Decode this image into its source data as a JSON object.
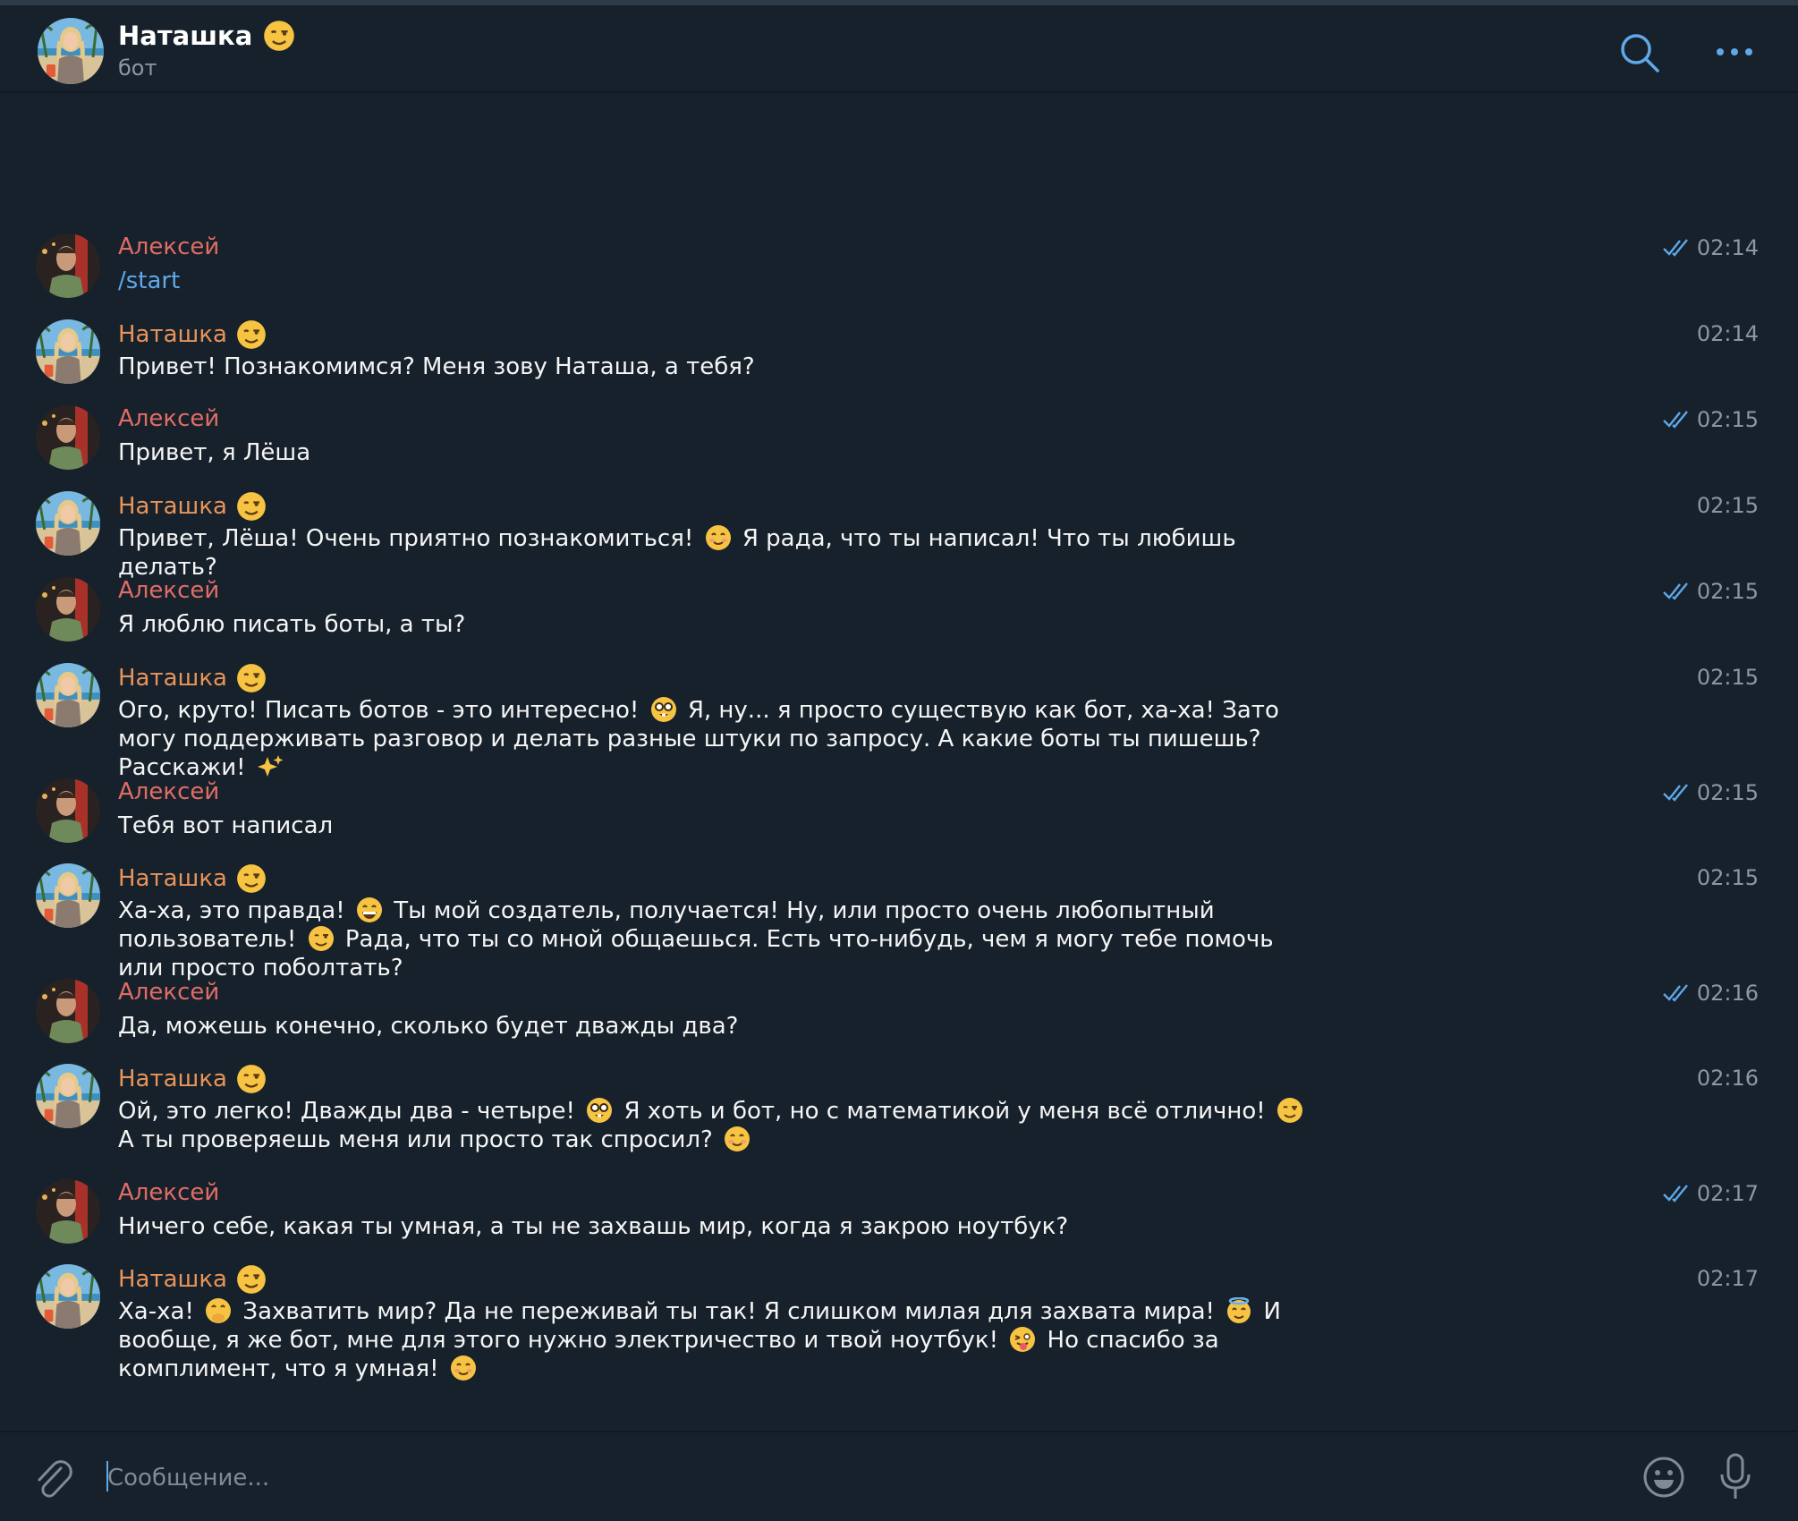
{
  "header": {
    "title": "Наташка",
    "subtitle": "бот"
  },
  "composer": {
    "placeholder": "Сообщение..."
  },
  "icons": {
    "search": "search-icon",
    "more": "more-icon",
    "attach": "paperclip-icon",
    "emoji": "smile-icon",
    "mic": "microphone-icon"
  },
  "colors": {
    "background": "#17212b",
    "user_name": "#e06c66",
    "bot_name": "#e8945a",
    "link": "#5fa8ea",
    "check": "#5fa8ea"
  },
  "messages": [
    {
      "sender": "Алексей",
      "time": "02:14",
      "text": "/start"
    },
    {
      "sender": "Наташка",
      "time": "02:14",
      "text": "Привет! Познакомимся? Меня зову Наташа, а тебя?"
    },
    {
      "sender": "Алексей",
      "time": "02:15",
      "text": "Привет, я Лёша"
    },
    {
      "sender": "Наташка",
      "time": "02:15",
      "text_a": "Привет, Лёша! Очень приятно познакомиться!",
      "text_b": "Я рада, что ты написал! Что ты любишь делать?"
    },
    {
      "sender": "Алексей",
      "time": "02:15",
      "text": "Я люблю писать боты, а ты?"
    },
    {
      "sender": "Наташка",
      "time": "02:15",
      "text_a": "Ого, круто! Писать ботов - это интересно!",
      "text_b": "Я, ну... я просто существую как бот, ха-ха! Зато могу поддерживать разговор и делать разные штуки по запросу. А какие боты ты пишешь? Расскажи!"
    },
    {
      "sender": "Алексей",
      "time": "02:15",
      "text": "Тебя вот написал"
    },
    {
      "sender": "Наташка",
      "time": "02:15",
      "text_a": "Ха-ха, это правда!",
      "text_b": "Ты мой создатель, получается! Ну, или просто очень любопытный пользователь!",
      "text_c": "Рада, что ты со мной общаешься. Есть что-нибудь, чем я могу тебе помочь или просто поболтать?"
    },
    {
      "sender": "Алексей",
      "time": "02:16",
      "text": "Да, можешь конечно, сколько будет дважды два?"
    },
    {
      "sender": "Наташка",
      "time": "02:16",
      "text_a": "Ой, это легко! Дважды два - четыре!",
      "text_b": "Я хоть и бот, но с математикой у меня всё отлично!",
      "text_c": "А ты проверяешь меня или просто так спросил?"
    },
    {
      "sender": "Алексей",
      "time": "02:17",
      "text": "Ничего себе, какая ты умная, а ты не захвашь мир, когда я закрою ноутбук?"
    },
    {
      "sender": "Наташка",
      "time": "02:17",
      "text_a": "Ха-ха!",
      "text_b": "Захватить мир? Да не переживай ты так! Я слишком милая для захвата мира!",
      "text_c": "И вообще, я же бот, мне для этого нужно электричество и твой ноутбук!",
      "text_d": "Но спасибо за комплимент, что я умная!"
    }
  ]
}
